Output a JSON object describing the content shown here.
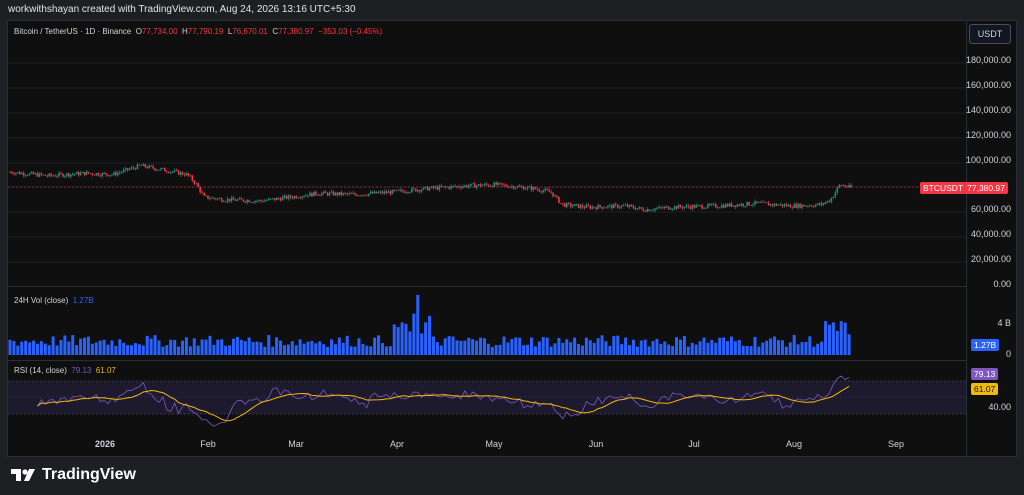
{
  "watermark_text": "workwithshayan created with TradingView.com, Aug 24, 2026 13:16 UTC+5:30",
  "symbol": {
    "title": "Bitcoin / TetherUS · 1D · Binance",
    "open_label": "O",
    "open": "77,734.00",
    "high_label": "H",
    "high": "77,790.19",
    "low_label": "L",
    "low": "76,670.01",
    "close_label": "C",
    "close": "77,380.97",
    "change": "−353.03 (−0.45%)"
  },
  "currency_button": "USDT",
  "price_axis": {
    "labels": [
      "180,000.00",
      "160,000.00",
      "140,000.00",
      "120,000.00",
      "100,000.00",
      "60,000.00",
      "40,000.00",
      "20,000.00",
      "0.00"
    ],
    "current_tag_symbol": "BTCUSDT",
    "current_tag_price": "77,380.97"
  },
  "volume": {
    "legend_label": "24H Vol (close)",
    "legend_value": "1.27B",
    "axis_labels": [
      "4 B",
      "0"
    ],
    "tag": "1.27B"
  },
  "rsi": {
    "legend_label": "RSI (14, close)",
    "rsi_value": "79.13",
    "ma_value": "61.07",
    "axis_label": "40.00",
    "tag_rsi": "79.13",
    "tag_ma": "61.07"
  },
  "time_axis": [
    "2026",
    "Feb",
    "Mar",
    "Apr",
    "May",
    "Jun",
    "Jul",
    "Aug",
    "Sep"
  ],
  "footer_brand": "TradingView",
  "colors": {
    "up": "#089981",
    "down": "#f23645",
    "volume": "#2962ff",
    "rsi_line": "#7e57c2",
    "rsi_ma": "#f0b90b",
    "background": "#0f0f0f"
  },
  "chart_data": {
    "type": "candlestick",
    "symbol": "BTCUSDT",
    "interval": "1D",
    "exchange": "Binance",
    "y_axis_range": [
      0,
      180000
    ],
    "series": [
      {
        "date_range": "2025-12 to 2026-01",
        "approx_price": 88000
      },
      {
        "date_range": "2026-01 mid",
        "approx_price": 95000
      },
      {
        "date_range": "2026-02 early",
        "approx_price": 70000
      },
      {
        "date_range": "2026-03",
        "approx_price": 68000
      },
      {
        "date_range": "2026-04",
        "approx_price": 75000
      },
      {
        "date_range": "2026-05",
        "approx_price": 80000
      },
      {
        "date_range": "2026-06 early",
        "approx_price": 62000
      },
      {
        "date_range": "2026-07",
        "approx_price": 63000
      },
      {
        "date_range": "2026-08",
        "approx_price": 64000
      },
      {
        "date_range": "2026-08-24",
        "approx_price": 77380.97
      }
    ],
    "last_close": 77380.97,
    "rsi": 79.13,
    "rsi_ma": 61.07,
    "last_volume": "1.27B"
  }
}
